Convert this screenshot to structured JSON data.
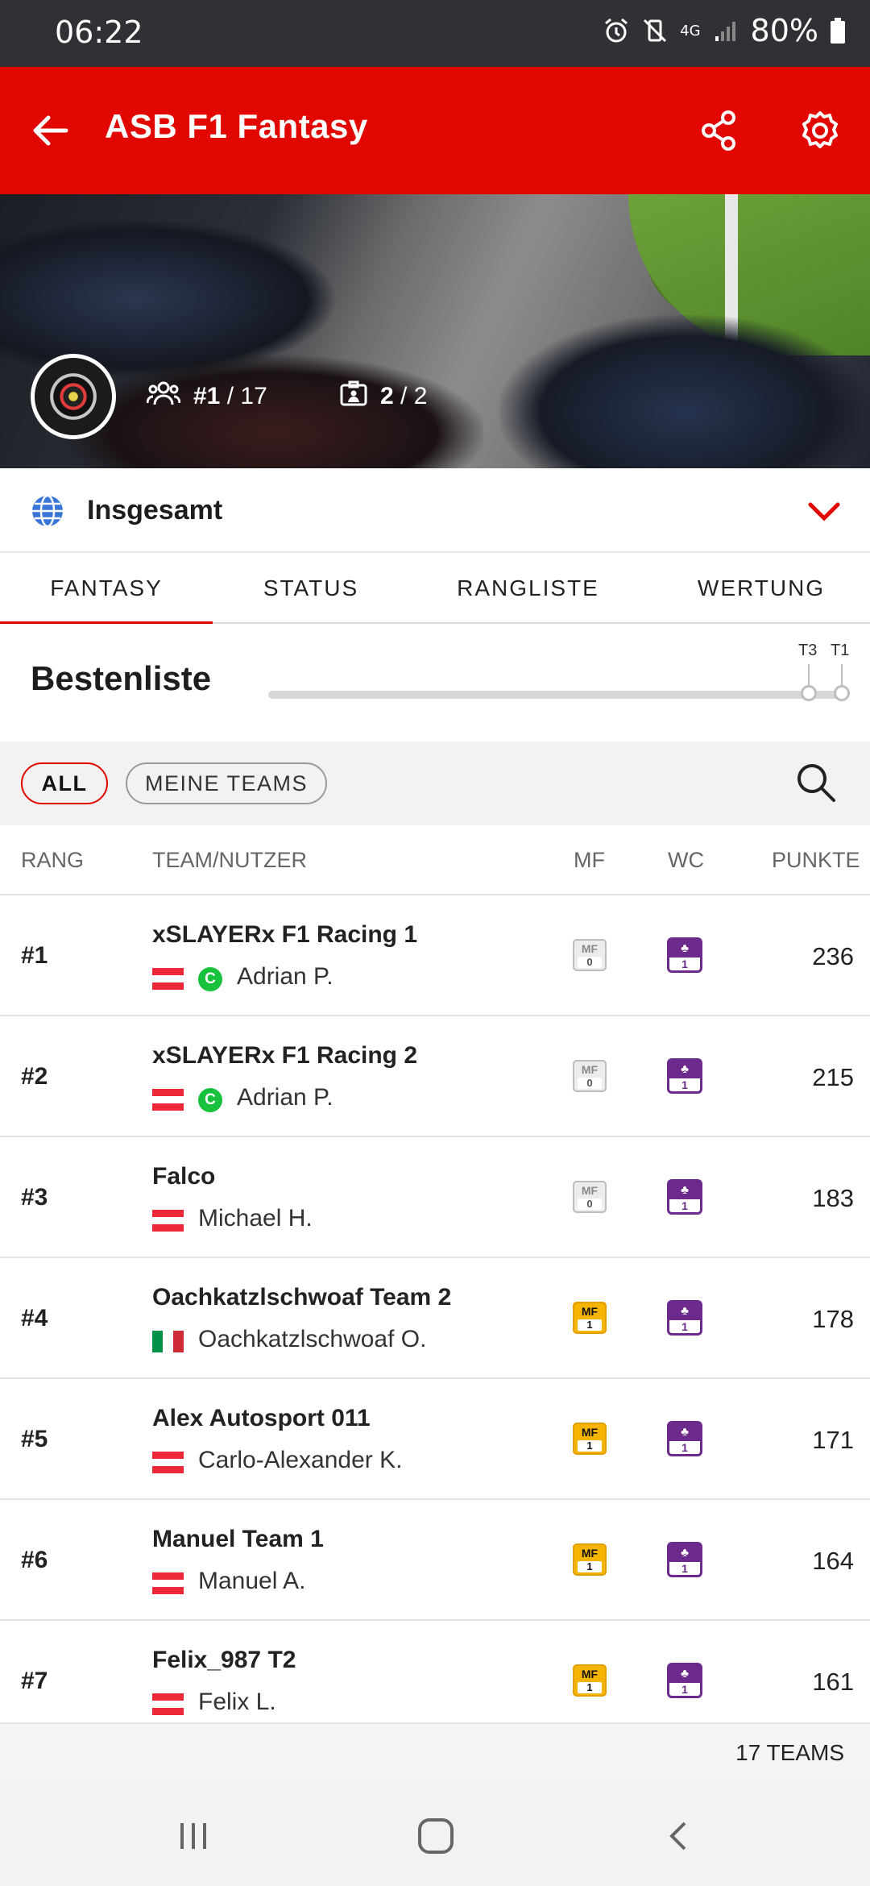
{
  "status_bar": {
    "time": "06:22",
    "network": "4G",
    "battery": "80%",
    "icons": [
      "alarm-icon",
      "vibrate-off-icon",
      "signal-icon",
      "battery-icon"
    ]
  },
  "app_bar": {
    "title": "ASB F1 Fantasy",
    "icons": [
      "back-arrow-icon",
      "share-icon",
      "gear-icon"
    ]
  },
  "hero": {
    "rank_prefix": "#1",
    "rank_total": "/ 17",
    "teams_current": "2",
    "teams_total": "/ 2"
  },
  "league_selector": {
    "label": "Insgesamt"
  },
  "tabs": [
    {
      "label": "FANTASY",
      "active": true
    },
    {
      "label": "STATUS",
      "active": false
    },
    {
      "label": "RANGLISTE",
      "active": false
    },
    {
      "label": "WERTUNG",
      "active": false
    }
  ],
  "leaderboard": {
    "title": "Bestenliste",
    "slider_labels": [
      "T3",
      "T1"
    ]
  },
  "filters": {
    "all": "ALL",
    "my_teams": "MEINE TEAMS"
  },
  "table": {
    "columns": {
      "rank": "RANG",
      "team": "TEAM/NUTZER",
      "mf": "MF",
      "wc": "WC",
      "points": "PUNKTE"
    },
    "mf_label": "MF",
    "rows": [
      {
        "rank": "#1",
        "team": "xSLAYERx F1 Racing 1",
        "user": "Adrian P.",
        "flag": "austria",
        "captain": "C",
        "mf": "0",
        "mf_active": false,
        "wc": "1",
        "points": "236"
      },
      {
        "rank": "#2",
        "team": "xSLAYERx F1 Racing 2",
        "user": "Adrian P.",
        "flag": "austria",
        "captain": "C",
        "mf": "0",
        "mf_active": false,
        "wc": "1",
        "points": "215"
      },
      {
        "rank": "#3",
        "team": "Falco",
        "user": "Michael H.",
        "flag": "austria",
        "captain": "",
        "mf": "0",
        "mf_active": false,
        "wc": "1",
        "points": "183"
      },
      {
        "rank": "#4",
        "team": "Oachkatzlschwoaf Team 2",
        "user": "Oachkatzlschwoaf O.",
        "flag": "italy",
        "captain": "",
        "mf": "1",
        "mf_active": true,
        "wc": "1",
        "points": "178"
      },
      {
        "rank": "#5",
        "team": "Alex Autosport 011",
        "user": "Carlo-Alexander K.",
        "flag": "austria",
        "captain": "",
        "mf": "1",
        "mf_active": true,
        "wc": "1",
        "points": "171"
      },
      {
        "rank": "#6",
        "team": "Manuel Team 1",
        "user": "Manuel A.",
        "flag": "austria",
        "captain": "",
        "mf": "1",
        "mf_active": true,
        "wc": "1",
        "points": "164"
      },
      {
        "rank": "#7",
        "team": "Felix_987 T2",
        "user": "Felix L.",
        "flag": "austria",
        "captain": "",
        "mf": "1",
        "mf_active": true,
        "wc": "1",
        "points": "161"
      }
    ]
  },
  "footer": {
    "count": "17 TEAMS"
  },
  "colors": {
    "brand_red": "#e10600",
    "mf_gold": "#f5b400",
    "wc_purple": "#6b2a8c",
    "captain_green": "#19c23c"
  }
}
